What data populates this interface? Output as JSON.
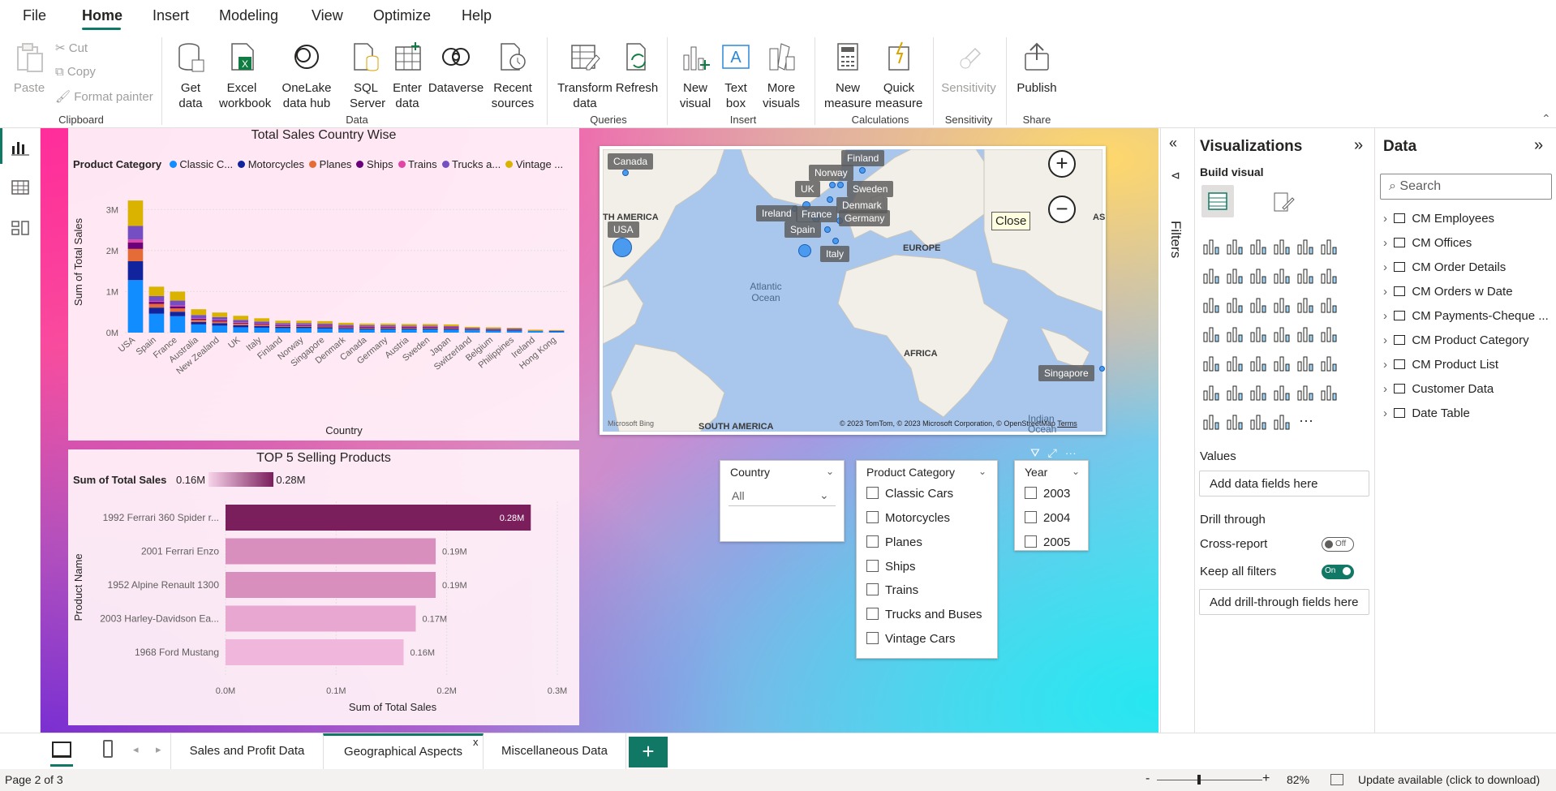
{
  "menu": {
    "items": [
      "File",
      "Home",
      "Insert",
      "Modeling",
      "View",
      "Optimize",
      "Help"
    ],
    "active": "Home"
  },
  "ribbon": {
    "clipboard": {
      "paste": "Paste",
      "cut": "Cut",
      "copy": "Copy",
      "format_painter": "Format painter",
      "label": "Clipboard"
    },
    "data": {
      "get_data": "Get data",
      "excel": "Excel workbook",
      "onelake": "OneLake data hub",
      "sql": "SQL Server",
      "enter": "Enter data",
      "dataverse": "Dataverse",
      "recent": "Recent sources",
      "label": "Data"
    },
    "queries": {
      "transform": "Transform data",
      "refresh": "Refresh",
      "label": "Queries"
    },
    "insert": {
      "new_visual": "New visual",
      "text_box": "Text box",
      "more_visuals": "More visuals",
      "label": "Insert"
    },
    "calculations": {
      "new_measure": "New measure",
      "quick_measure": "Quick measure",
      "label": "Calculations"
    },
    "sensitivity": {
      "sensitivity": "Sensitivity",
      "label": "Sensitivity"
    },
    "share": {
      "publish": "Publish",
      "label": "Share"
    }
  },
  "visual1": {
    "title": "Total Sales Country Wise",
    "legend_title": "Product Category",
    "legend": [
      {
        "name": "Classic C...",
        "color": "#118dff"
      },
      {
        "name": "Motorcycles",
        "color": "#12239e"
      },
      {
        "name": "Planes",
        "color": "#e66c37"
      },
      {
        "name": "Ships",
        "color": "#6b007b"
      },
      {
        "name": "Trains",
        "color": "#e044a7"
      },
      {
        "name": "Trucks a...",
        "color": "#744ec2"
      },
      {
        "name": "Vintage ...",
        "color": "#d9b300"
      }
    ],
    "ylabel": "Sum of Total Sales",
    "xlabel": "Country"
  },
  "visual2": {
    "title": "TOP 5 Selling Products",
    "legend_title": "Sum of Total Sales",
    "legend_min": "0.16M",
    "legend_max": "0.28M",
    "ylabel": "Product Name",
    "xlabel": "Sum of Total Sales"
  },
  "chart_data": [
    {
      "type": "bar",
      "title": "Total Sales Country Wise",
      "xlabel": "Country",
      "ylabel": "Sum of Total Sales",
      "yticks": [
        "0M",
        "1M",
        "2M",
        "3M"
      ],
      "ylim": [
        0,
        3500000
      ],
      "categories": [
        "USA",
        "Spain",
        "France",
        "Australia",
        "New Zealand",
        "UK",
        "Italy",
        "Finland",
        "Norway",
        "Singapore",
        "Denmark",
        "Canada",
        "Germany",
        "Austria",
        "Sweden",
        "Japan",
        "Switzerland",
        "Belgium",
        "Philippines",
        "Ireland",
        "Hong Kong"
      ],
      "series": [
        {
          "name": "Classic C...",
          "values": [
            1280000,
            460000,
            400000,
            200000,
            170000,
            130000,
            120000,
            110000,
            110000,
            100000,
            90000,
            80000,
            80000,
            80000,
            80000,
            70000,
            60000,
            50000,
            50000,
            40000,
            30000
          ]
        },
        {
          "name": "Motorcycles",
          "values": [
            460000,
            150000,
            110000,
            60000,
            60000,
            50000,
            40000,
            30000,
            30000,
            30000,
            20000,
            20000,
            20000,
            20000,
            20000,
            20000,
            10000,
            10000,
            10000,
            0,
            10000
          ]
        },
        {
          "name": "Planes",
          "values": [
            300000,
            90000,
            80000,
            50000,
            40000,
            40000,
            30000,
            20000,
            20000,
            20000,
            20000,
            20000,
            20000,
            20000,
            20000,
            20000,
            10000,
            10000,
            10000,
            10000,
            10000
          ]
        },
        {
          "name": "Ships",
          "values": [
            160000,
            50000,
            50000,
            30000,
            30000,
            20000,
            20000,
            20000,
            20000,
            20000,
            20000,
            20000,
            20000,
            20000,
            20000,
            20000,
            10000,
            10000,
            10000,
            0,
            0
          ]
        },
        {
          "name": "Trains",
          "values": [
            70000,
            20000,
            20000,
            10000,
            10000,
            10000,
            10000,
            10000,
            10000,
            10000,
            10000,
            10000,
            10000,
            10000,
            10000,
            10000,
            0,
            0,
            0,
            0,
            0
          ]
        },
        {
          "name": "Trucks a...",
          "values": [
            330000,
            120000,
            120000,
            80000,
            70000,
            60000,
            50000,
            40000,
            40000,
            40000,
            30000,
            30000,
            30000,
            20000,
            20000,
            20000,
            20000,
            20000,
            20000,
            0,
            0
          ]
        },
        {
          "name": "Vintage ...",
          "values": [
            620000,
            230000,
            220000,
            140000,
            110000,
            100000,
            80000,
            60000,
            60000,
            60000,
            50000,
            40000,
            40000,
            40000,
            40000,
            40000,
            30000,
            30000,
            20000,
            20000,
            10000
          ]
        }
      ]
    },
    {
      "type": "bar",
      "orientation": "horizontal",
      "title": "TOP 5 Selling Products",
      "xlabel": "Sum of Total Sales",
      "ylabel": "Product Name",
      "xticks": [
        "0.0M",
        "0.1M",
        "0.2M",
        "0.3M"
      ],
      "xlim": [
        0,
        300000
      ],
      "categories": [
        "1992 Ferrari 360 Spider r...",
        "2001 Ferrari Enzo",
        "1952 Alpine Renault 1300",
        "2003 Harley-Davidson Ea...",
        "1968 Ford Mustang"
      ],
      "values": [
        276000,
        190000,
        190000,
        172000,
        161000
      ],
      "value_labels": [
        "0.28M",
        "0.19M",
        "0.19M",
        "0.17M",
        "0.16M"
      ]
    }
  ],
  "map": {
    "places": [
      "Canada",
      "USA",
      "Finland",
      "Norway",
      "Sweden",
      "UK",
      "Denmark",
      "Ireland",
      "France",
      "Germany",
      "Spain",
      "Italy",
      "Singapore"
    ],
    "regions": [
      "TH AMERICA",
      "Atlantic Ocean",
      "AFRICA",
      "SOUTH AMERICA",
      "EUROPE",
      "AS",
      "Indian Ocean"
    ],
    "tooltip": "Close",
    "bing": "Microsoft Bing",
    "copyright": "© 2023 TomTom, © 2023 Microsoft Corporation, © OpenStreetMap",
    "terms": "Terms"
  },
  "slicers": {
    "country": {
      "title": "Country",
      "value": "All"
    },
    "category": {
      "title": "Product Category",
      "items": [
        "Classic Cars",
        "Motorcycles",
        "Planes",
        "Ships",
        "Trains",
        "Trucks and Buses",
        "Vintage Cars"
      ]
    },
    "year": {
      "title": "Year",
      "items": [
        "2003",
        "2004",
        "2005"
      ]
    }
  },
  "filters": {
    "label": "Filters"
  },
  "viz": {
    "title": "Visualizations",
    "build": "Build visual",
    "values": "Values",
    "add_fields": "Add data fields here",
    "drill": "Drill through",
    "cross": "Cross-report",
    "cross_state": "Off",
    "keep": "Keep all filters",
    "keep_state": "On",
    "add_drill": "Add drill-through fields here"
  },
  "datapane": {
    "title": "Data",
    "search": "Search",
    "tables": [
      "CM Employees",
      "CM Offices",
      "CM Order Details",
      "CM Orders w Date",
      "CM Payments-Cheque ...",
      "CM Product Category",
      "CM Product List",
      "Customer Data",
      "Date Table"
    ]
  },
  "tabs": {
    "items": [
      "Sales and Profit Data",
      "Geographical Aspects",
      "Miscellaneous Data"
    ],
    "active": "Geographical Aspects",
    "close": "x",
    "add": "+"
  },
  "status": {
    "page": "Page 2 of 3",
    "zoom": "82%",
    "update": "Update available (click to download)",
    "minus": "-",
    "plus": "+"
  }
}
